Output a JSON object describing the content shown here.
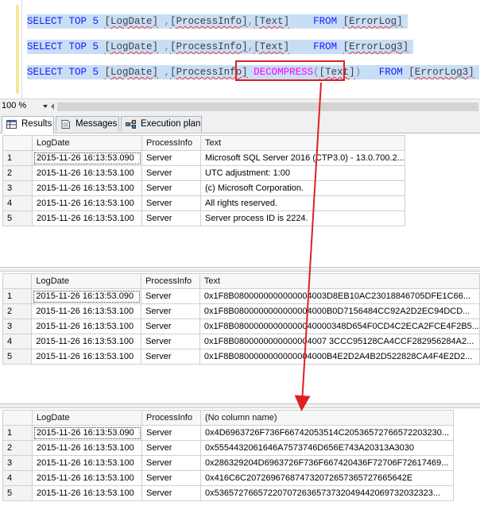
{
  "editor": {
    "lines": [
      {
        "kw1": "SELECT TOP 5 ",
        "c1": "[LogDate]",
        "s1": " ,",
        "c2": "[ProcessInfo]",
        "s2": ",",
        "c3": "[Text]",
        "mid": "    ",
        "kw2": "FROM ",
        "tbl": "[ErrorLog]"
      },
      {
        "kw1": "SELECT TOP 5 ",
        "c1": "[LogDate]",
        "s1": " ,",
        "c2": "[ProcessInfo]",
        "s2": ",",
        "c3": "[Text]",
        "mid": "    ",
        "kw2": "FROM ",
        "tbl": "[ErrorLog3]"
      },
      {
        "kw1": "SELECT TOP 5 ",
        "c1": "[LogDate]",
        "s1": " ,",
        "c2": "[ProcessInfo]",
        "s2": " ",
        "fn": "DECOMPRESS",
        "fo": "(",
        "c3": "[Text]",
        "fc": ")",
        "mid": "   ",
        "kw2": "FROM ",
        "tbl": "[ErrorLog3]"
      }
    ]
  },
  "zoom": {
    "value": "100 %"
  },
  "tabs": [
    {
      "label": "Results"
    },
    {
      "label": "Messages"
    },
    {
      "label": "Execution plan"
    }
  ],
  "grids": [
    {
      "headers": [
        "",
        "LogDate",
        "ProcessInfo",
        "Text"
      ],
      "rows": [
        [
          "1",
          "2015-11-26 16:13:53.090",
          "Server",
          "Microsoft SQL Server 2016 (CTP3.0) - 13.0.700.2..."
        ],
        [
          "2",
          "2015-11-26 16:13:53.100",
          "Server",
          "UTC adjustment: 1:00"
        ],
        [
          "3",
          "2015-11-26 16:13:53.100",
          "Server",
          "(c) Microsoft Corporation."
        ],
        [
          "4",
          "2015-11-26 16:13:53.100",
          "Server",
          "All rights reserved."
        ],
        [
          "5",
          "2015-11-26 16:13:53.100",
          "Server",
          "Server process ID is 2224."
        ]
      ]
    },
    {
      "headers": [
        "",
        "LogDate",
        "ProcessInfo",
        "Text"
      ],
      "rows": [
        [
          "1",
          "2015-11-26 16:13:53.090",
          "Server",
          "0x1F8B0800000000000004003D8EB10AC23018846705DFE1C66..."
        ],
        [
          "2",
          "2015-11-26 16:13:53.100",
          "Server",
          "0x1F8B0800000000000004000B0D7156484CC92A2D2EC94DCD..."
        ],
        [
          "3",
          "2015-11-26 16:13:53.100",
          "Server",
          "0x1F8B08000000000000040000348D654F0CD4C2ECA2FCE4F2B5..."
        ],
        [
          "4",
          "2015-11-26 16:13:53.100",
          "Server",
          "0x1F8B0800000000000004007 3CCC95128CA4CCF282956284A2..."
        ],
        [
          "5",
          "2015-11-26 16:13:53.100",
          "Server",
          "0x1F8B0800000000000004000B4E2D2A4B2D522828CA4F4E2D2..."
        ]
      ]
    },
    {
      "headers": [
        "",
        "LogDate",
        "ProcessInfo",
        "(No column name)"
      ],
      "rows": [
        [
          "1",
          "2015-11-26 16:13:53.090",
          "Server",
          "0x4D6963726F736F66742053514C20536572766572203230..."
        ],
        [
          "2",
          "2015-11-26 16:13:53.100",
          "Server",
          "0x5554432061646A7573746D656E743A20313A3030"
        ],
        [
          "3",
          "2015-11-26 16:13:53.100",
          "Server",
          "0x286329204D6963726F736F667420436F72706F72617469..."
        ],
        [
          "4",
          "2015-11-26 16:13:53.100",
          "Server",
          "0x416C6C207269676874732072657365727665642E"
        ],
        [
          "5",
          "2015-11-26 16:13:53.100",
          "Server",
          "0x536572766572207072636573732049442069732032323..."
        ]
      ]
    }
  ],
  "colors": {
    "highlight": "#c8def5",
    "keyword": "#1a1aff",
    "function": "#ff00ff",
    "callout": "#e02020"
  }
}
